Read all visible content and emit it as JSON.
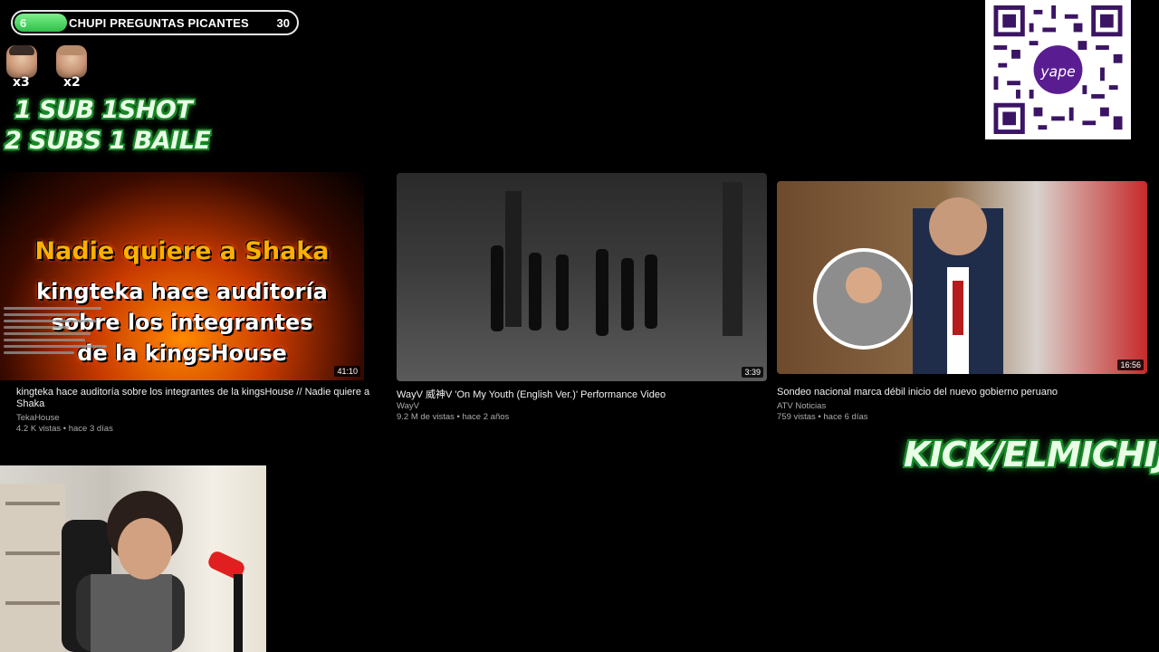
{
  "goal": {
    "count": "6",
    "title": "CHUPI PREGUNTAS PICANTES",
    "target": "30",
    "progress_fraction": 0.2
  },
  "multipliers": [
    {
      "label": "x3"
    },
    {
      "label": "x2"
    }
  ],
  "rules": [
    "1 SUB  1SHOT",
    "2 SUBS 1 BAILE"
  ],
  "qr": {
    "brand": "yape"
  },
  "videos": [
    {
      "title": "kingteka hace auditoría sobre los integrantes de la kingsHouse // Nadie quiere a",
      "title_wrap": "Shaka",
      "channel": "TekaHouse",
      "meta": "4.2 K vistas • hace 3 días",
      "duration": "41:10",
      "thumb_lines": [
        "Nadie quiere a Shaka",
        "kingteka hace auditoría",
        "sobre los integrantes",
        "de la kingsHouse"
      ]
    },
    {
      "title": "WayV 威神V 'On My Youth (English Ver.)' Performance Video",
      "channel": "WayV",
      "meta": "9.2 M de vistas • hace 2 años",
      "duration": "3:39"
    },
    {
      "title": "Sondeo nacional marca débil inicio del nuevo gobierno peruano",
      "channel": "ATV Noticias",
      "meta": "759 vistas • hace 6 días",
      "duration": "16:56"
    }
  ],
  "kick": "KICK/ELMICHIJ",
  "colors": {
    "accent_green": "#2fbf4a",
    "outline_green": "#1a8a2a"
  }
}
